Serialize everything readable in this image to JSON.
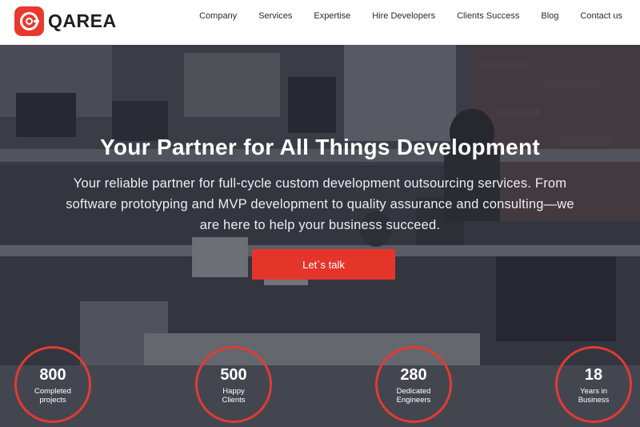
{
  "header": {
    "logo_text": "QAREA",
    "nav": [
      {
        "label": "Company"
      },
      {
        "label": "Services"
      },
      {
        "label": "Expertise"
      },
      {
        "label": "Hire Developers"
      },
      {
        "label": "Clients Success"
      },
      {
        "label": "Blog"
      },
      {
        "label": "Contact us"
      }
    ]
  },
  "hero": {
    "title": "Your Partner for All Things Development",
    "description": "Your reliable partner for full-cycle custom development outsourcing services. From software prototyping and MVP development to quality assurance and consulting—we are here to help your business succeed.",
    "cta_label": "Let`s talk"
  },
  "stats": [
    {
      "number": "800",
      "line1": "Completed",
      "line2": "projects"
    },
    {
      "number": "500",
      "line1": "Happy",
      "line2": "Clients"
    },
    {
      "number": "280",
      "line1": "Dedicated",
      "line2": "Engineers"
    },
    {
      "number": "18",
      "line1": "Years in",
      "line2": "Business"
    }
  ],
  "colors": {
    "accent": "#e5352b",
    "overlay": "#222530",
    "header_bg": "#ffffff",
    "text_dark": "#2a2a2a"
  }
}
